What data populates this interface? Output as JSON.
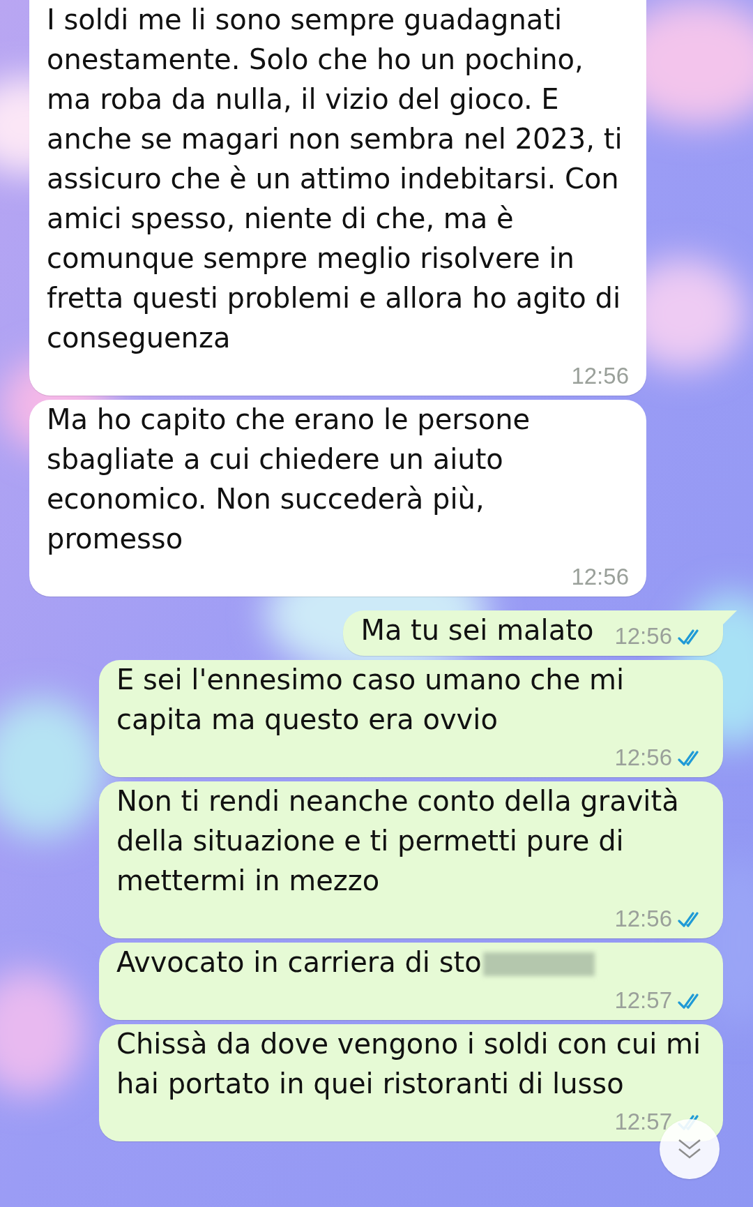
{
  "messages": [
    {
      "outgoing": false,
      "text": "I soldi me li sono sempre guadagnati onestamente. Solo che ho un pochino, ma roba da nulla, il vizio del gioco. E anche se magari non sembra nel 2023, ti assicuro che è un attimo indebitarsi. Con amici spesso, niente di che, ma è comunque sempre meglio risolvere in fretta questi problemi e allora ho agito di conseguenza",
      "time": "12:56"
    },
    {
      "outgoing": false,
      "text": "Ma ho capito che erano le persone sbagliate a cui chiedere un aiuto economico. Non succederà più, promesso",
      "time": "12:56"
    },
    {
      "outgoing": true,
      "text": "Ma tu sei malato",
      "time": "12:56",
      "read": true
    },
    {
      "outgoing": true,
      "text": "E sei l'ennesimo caso umano che mi capita ma questo era ovvio",
      "time": "12:56",
      "read": true
    },
    {
      "outgoing": true,
      "text": "Non ti rendi neanche conto della gravità della situazione e ti permetti pure di mettermi in mezzo",
      "time": "12:56",
      "read": true
    },
    {
      "outgoing": true,
      "text": "Avvocato in carriera di sto",
      "time": "12:57",
      "read": true,
      "redacted": true
    },
    {
      "outgoing": true,
      "text": "Chissà da dove vengono i soldi con cui mi hai portato in quei ristoranti di lusso",
      "time": "12:57",
      "read": true
    }
  ],
  "scroll_down_button": true
}
